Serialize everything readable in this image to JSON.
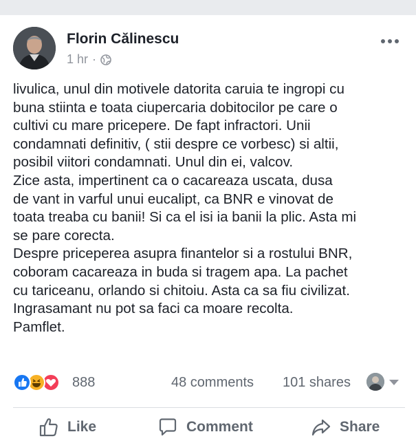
{
  "post": {
    "author": "Florin Călinescu",
    "time": "1 hr",
    "privacy_icon": "globe-icon",
    "lines": [
      "livulica, unul din motivele datorita caruia te ingropi cu",
      "buna stiinta e toata ciupercaria dobitocilor pe care o",
      "cultivi cu mare pricepere. De fapt infractori. Unii",
      "condamnati definitiv, ( stii despre ce vorbesc) si altii,",
      "posibil viitori condamnati. Unul din ei, valcov.",
      "Zice asta,  impertinent ca o cacareaza uscata, dusa",
      "de vant in varful unui eucalipt, ca BNR e vinovat de",
      "toata treaba cu banii! Si ca el isi ia banii la plic. Asta mi",
      "se pare corecta.",
      "Despre priceperea asupra finantelor si a rostului BNR,",
      "coboram cacareaza in buda si tragem apa. La pachet",
      "cu tariceanu, orlando si chitoiu. Asta ca sa fiu civilizat.",
      "Ingrasamant nu pot sa faci ca moare recolta.",
      "Pamflet."
    ]
  },
  "stats": {
    "reactions": [
      "like",
      "haha",
      "love"
    ],
    "reaction_count": "888",
    "comments": "48 comments",
    "shares": "101 shares"
  },
  "actions": {
    "like": "Like",
    "comment": "Comment",
    "share": "Share"
  },
  "colors": {
    "like_blue": "#1877f2",
    "haha_yellow": "#f7b125",
    "love_red": "#f33e58",
    "meta_gray": "#90949c"
  }
}
